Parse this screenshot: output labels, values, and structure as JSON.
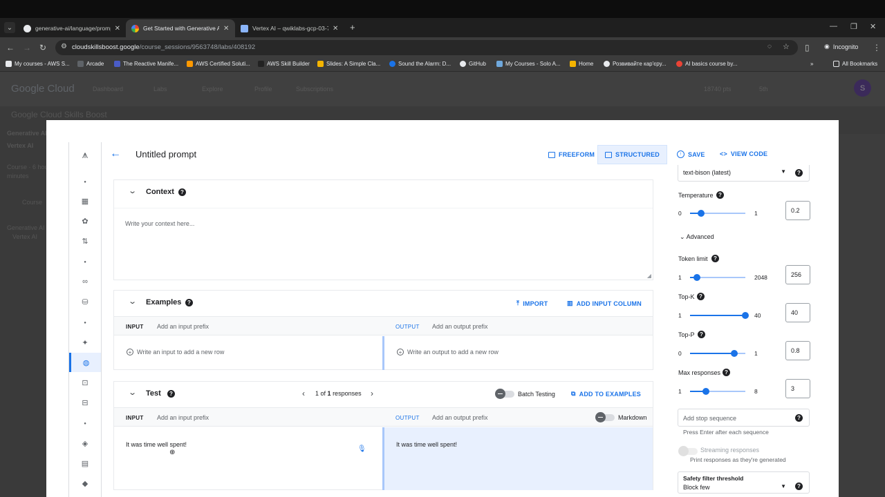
{
  "browser": {
    "tabs": [
      {
        "title": "generative-ai/language/prompt",
        "active": false
      },
      {
        "title": "Get Started with Generative AI",
        "active": true
      },
      {
        "title": "Vertex AI – qwiklabs-gcp-03-70",
        "active": false
      }
    ],
    "url_host": "cloudskillsboost.google",
    "url_path": "/course_sessions/9563748/labs/408192",
    "incognito_label": "Incognito",
    "bookmarks": [
      "My courses - AWS S...",
      "Arcade",
      "The Reactive Manife...",
      "AWS Certified Soluti...",
      "AWS Skill Builder",
      "Slides: A Simple Cla...",
      "Sound the Alarm: D...",
      "GitHub",
      "My Courses - Solo A...",
      "Home",
      "Розвивайте кар'єру...",
      "AI basics course by..."
    ],
    "all_bookmarks": "All Bookmarks"
  },
  "background_page": {
    "logo": "Google Cloud",
    "nav": [
      "Dashboard",
      "Labs",
      "Explore",
      "Profile",
      "Subscriptions"
    ],
    "site_title": "Google Cloud Skills Boost",
    "points": "18740 pts",
    "points_icon": "5th",
    "avatar_letter": "S",
    "sidebar": [
      "Generative AI",
      "Vertex AI",
      "Course · 6 hours",
      "minutes",
      "Course",
      "Generative AI",
      "Vertex AI"
    ]
  },
  "prompt_editor": {
    "title": "Untitled prompt",
    "mode_freeform": "FREEFORM",
    "mode_structured": "STRUCTURED",
    "save": "SAVE",
    "view_code": "VIEW CODE",
    "context": {
      "title": "Context",
      "placeholder": "Write your context here..."
    },
    "examples": {
      "title": "Examples",
      "import": "IMPORT",
      "add_input_column": "ADD INPUT COLUMN",
      "input_label": "INPUT",
      "input_prefix": "Add an input prefix",
      "output_label": "OUTPUT",
      "output_prefix": "Add an output prefix",
      "input_row": "Write an input to add a new row",
      "output_row": "Write an output to add a new row"
    },
    "test": {
      "title": "Test",
      "pager_pre": "1 of",
      "pager_num": "1",
      "pager_post": "responses",
      "batch_testing": "Batch Testing",
      "add_to_examples": "ADD TO EXAMPLES",
      "input_label": "INPUT",
      "input_prefix": "Add an input prefix",
      "output_label": "OUTPUT",
      "output_prefix": "Add an output prefix",
      "markdown": "Markdown",
      "input_text": "It was time well spent!",
      "output_text": "It was time well spent!"
    }
  },
  "settings": {
    "model": "text-bison (latest)",
    "temperature": {
      "label": "Temperature",
      "min": "0",
      "max": "1",
      "value": "0.2",
      "fraction": 0.2
    },
    "advanced": "Advanced",
    "token_limit": {
      "label": "Token limit",
      "min": "1",
      "max": "2048",
      "value": "256",
      "fraction": 0.12
    },
    "top_k": {
      "label": "Top-K",
      "min": "1",
      "max": "40",
      "value": "40",
      "fraction": 1.0
    },
    "top_p": {
      "label": "Top-P",
      "min": "0",
      "max": "1",
      "value": "0.8",
      "fraction": 0.8
    },
    "max_responses": {
      "label": "Max responses",
      "min": "1",
      "max": "8",
      "value": "3",
      "fraction": 0.29
    },
    "stop_sequence_placeholder": "Add stop sequence",
    "stop_sequence_hint": "Press Enter after each sequence",
    "streaming": "Streaming responses",
    "streaming_hint": "Print responses as they're generated",
    "safety_label": "Safety filter threshold",
    "safety_value": "Block few"
  },
  "colors": {
    "accent": "#1a73e8",
    "output_bg": "#e8f0fe"
  }
}
